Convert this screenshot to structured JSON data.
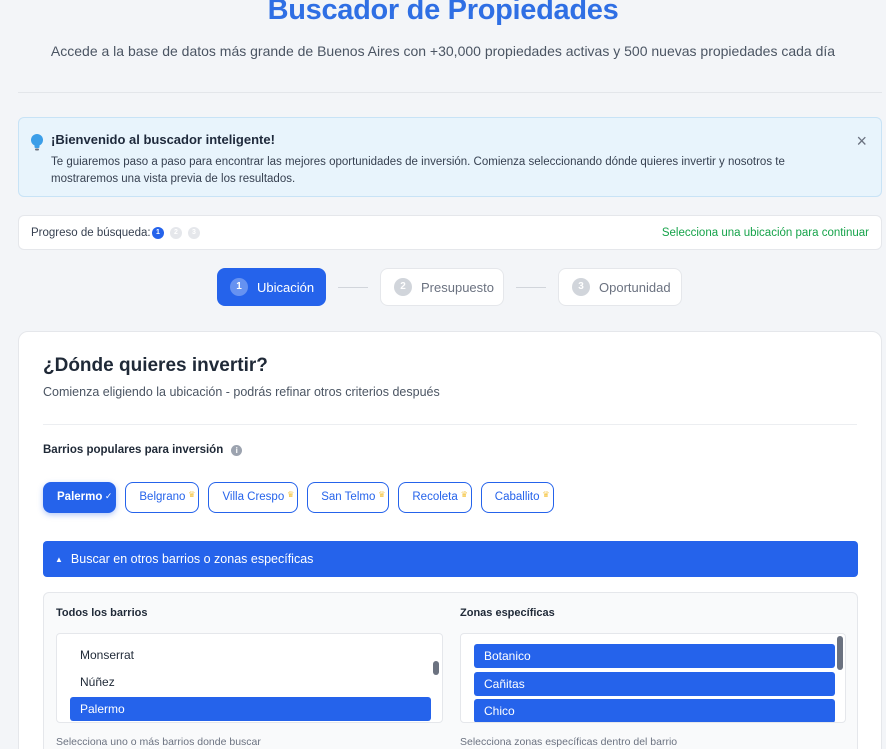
{
  "header": {
    "title": "Buscador de Propiedades",
    "subtitle": "Accede a la base de datos más grande de Buenos Aires con +30,000 propiedades activas y 500 nuevas propiedades cada día"
  },
  "welcome": {
    "icon": "lightbulb-icon",
    "title": "¡Bienvenido al buscador inteligente!",
    "text": "Te guiaremos paso a paso para encontrar las mejores oportunidades de inversión. Comienza seleccionando dónde quieres invertir y nosotros te mostraremos una vista previa de los resultados.",
    "close": "×"
  },
  "progress": {
    "label": "Progreso de búsqueda:",
    "dots": [
      "1",
      "2",
      "3"
    ],
    "status": "Selecciona una ubicación para continuar"
  },
  "steps": [
    {
      "num": "1",
      "label": "Ubicación",
      "active": true
    },
    {
      "num": "2",
      "label": "Presupuesto",
      "active": false
    },
    {
      "num": "3",
      "label": "Oportunidad",
      "active": false
    }
  ],
  "card": {
    "title": "¿Dónde quieres invertir?",
    "subtitle": "Comienza eligiendo la ubicación - podrás refinar otros criterios después",
    "barrios_label": "Barrios populares para inversión",
    "info_icon": "i",
    "chips": [
      {
        "label": "Palermo",
        "selected": true
      },
      {
        "label": "Belgrano",
        "selected": false
      },
      {
        "label": "Villa Crespo",
        "selected": false
      },
      {
        "label": "San Telmo",
        "selected": false
      },
      {
        "label": "Recoleta",
        "selected": false
      },
      {
        "label": "Caballito",
        "selected": false
      }
    ],
    "expand_label": "Buscar en otros barrios o zonas específicas",
    "todos_label": "Todos los barrios",
    "todos_options": [
      {
        "label": "Monserrat",
        "selected": false
      },
      {
        "label": "Núñez",
        "selected": false
      },
      {
        "label": "Palermo",
        "selected": true
      }
    ],
    "todos_helper": "Selecciona uno o más barrios donde buscar",
    "zonas_label": "Zonas específicas",
    "zonas_options": [
      {
        "label": "Botanico",
        "selected": true
      },
      {
        "label": "Cañitas",
        "selected": true
      },
      {
        "label": "Chico",
        "selected": true
      }
    ],
    "zonas_helper": "Selecciona zonas específicas dentro del barrio"
  },
  "colors": {
    "accent": "#2563eb",
    "title": "#2f6fe4",
    "success": "#16a34a",
    "banner_bg": "#e8f4fc"
  }
}
